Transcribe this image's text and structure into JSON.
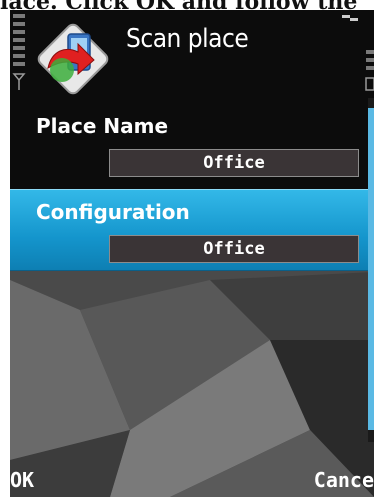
{
  "caption": "lace. Click OK and follow the",
  "header": {
    "title": "Scan place",
    "app_icon": "arrow-switch-icon"
  },
  "fields": [
    {
      "label": "Place Name",
      "value": "Office"
    },
    {
      "label": "Configuration",
      "value": "Office"
    }
  ],
  "softkeys": {
    "left": "OK",
    "right": "Cance"
  },
  "colors": {
    "highlight": "#1a9bd2",
    "background": "#0d0d0d"
  }
}
